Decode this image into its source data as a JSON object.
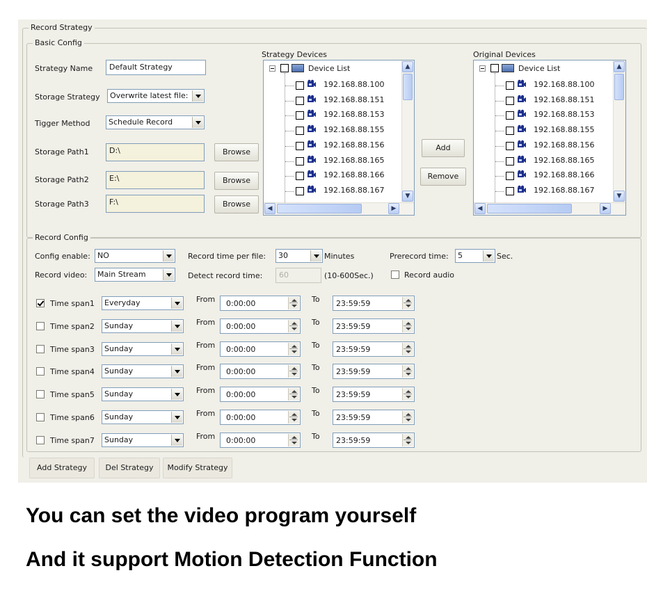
{
  "record_strategy": {
    "title": "Record Strategy",
    "basic_config": {
      "title": "Basic Config",
      "strategy_name_label": "Strategy Name",
      "strategy_name_value": "Default Strategy",
      "storage_strategy_label": "Storage Strategy",
      "storage_strategy_value": "Overwrite latest file:",
      "trigger_method_label": "Tigger Method",
      "trigger_method_value": "Schedule Record",
      "storage_path1_label": "Storage Path1",
      "storage_path1_value": "D:\\",
      "storage_path2_label": "Storage Path2",
      "storage_path2_value": "E:\\",
      "storage_path3_label": "Storage Path3",
      "storage_path3_value": "F:\\",
      "browse_label": "Browse"
    },
    "strategy_devices": {
      "title": "Strategy Devices",
      "root": "Device List",
      "items": [
        "192.168.88.100",
        "192.168.88.151",
        "192.168.88.153",
        "192.168.88.155",
        "192.168.88.156",
        "192.168.88.165",
        "192.168.88.166",
        "192.168.88.167"
      ]
    },
    "original_devices": {
      "title": "Original Devices",
      "root": "Device List",
      "items": [
        "192.168.88.100",
        "192.168.88.151",
        "192.168.88.153",
        "192.168.88.155",
        "192.168.88.156",
        "192.168.88.165",
        "192.168.88.166",
        "192.168.88.167"
      ]
    },
    "add_label": "Add",
    "remove_label": "Remove",
    "record_config": {
      "title": "Record Config",
      "config_enable_label": "Config enable:",
      "config_enable_value": "NO",
      "record_time_label": "Record time per file:",
      "record_time_value": "30",
      "minutes_label": "Minutes",
      "prerecord_label": "Prerecord time:",
      "prerecord_value": "5",
      "sec_label": "Sec.",
      "record_video_label": "Record video:",
      "record_video_value": "Main Stream",
      "detect_time_label": "Detect record time:",
      "detect_time_value": "60",
      "detect_range_label": "(10-600Sec.)",
      "record_audio_label": "Record audio",
      "record_audio_checked": false,
      "from_label": "From",
      "to_label": "To",
      "time_spans": [
        {
          "label": "Time span1",
          "checked": true,
          "day": "Everyday",
          "from": "0:00:00",
          "to": "23:59:59"
        },
        {
          "label": "Time span2",
          "checked": false,
          "day": "Sunday",
          "from": "0:00:00",
          "to": "23:59:59"
        },
        {
          "label": "Time span3",
          "checked": false,
          "day": "Sunday",
          "from": "0:00:00",
          "to": "23:59:59"
        },
        {
          "label": "Time span4",
          "checked": false,
          "day": "Sunday",
          "from": "0:00:00",
          "to": "23:59:59"
        },
        {
          "label": "Time span5",
          "checked": false,
          "day": "Sunday",
          "from": "0:00:00",
          "to": "23:59:59"
        },
        {
          "label": "Time span6",
          "checked": false,
          "day": "Sunday",
          "from": "0:00:00",
          "to": "23:59:59"
        },
        {
          "label": "Time span7",
          "checked": false,
          "day": "Sunday",
          "from": "0:00:00",
          "to": "23:59:59"
        }
      ]
    },
    "add_strategy_label": "Add Strategy",
    "del_strategy_label": "Del Strategy",
    "modify_strategy_label": "Modify Strategy"
  },
  "captions": {
    "line1": "You can set the video program yourself",
    "line2": "And it support Motion Detection Function"
  }
}
